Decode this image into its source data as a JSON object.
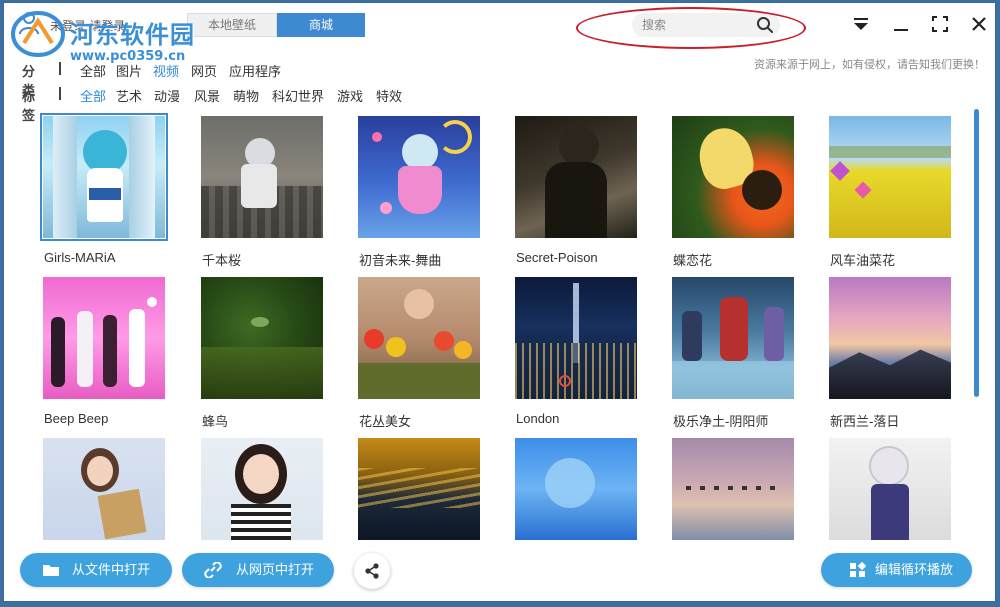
{
  "titlebar": {
    "user_status": "未登录 请登录",
    "tabs": [
      {
        "label": "本地壁纸",
        "active": false
      },
      {
        "label": "商城",
        "active": true
      }
    ],
    "search": {
      "placeholder": "搜索",
      "value": ""
    },
    "watermark": {
      "title": "河东软件园",
      "url": "www.pc0359.cn"
    }
  },
  "filters": {
    "category": {
      "label": "分类",
      "options": [
        "全部",
        "图片",
        "视频",
        "网页",
        "应用程序"
      ],
      "active": "视频"
    },
    "tags": {
      "label": "标签",
      "options": [
        "全部",
        "艺术",
        "动漫",
        "风景",
        "萌物",
        "科幻世界",
        "游戏",
        "特效"
      ],
      "active": "全部"
    },
    "disclaimer": "资源来源于网上，如有侵权，请告知我们更换！"
  },
  "items": [
    {
      "title": "Girls-MARiA",
      "selected": true
    },
    {
      "title": "千本桜"
    },
    {
      "title": "初音未来-舞曲"
    },
    {
      "title": "Secret-Poison"
    },
    {
      "title": "蝶恋花"
    },
    {
      "title": "风车油菜花"
    },
    {
      "title": "Beep Beep"
    },
    {
      "title": "蜂鸟"
    },
    {
      "title": "花丛美女"
    },
    {
      "title": "London"
    },
    {
      "title": "极乐净土-阴阳师"
    },
    {
      "title": "新西兰-落日"
    },
    {
      "title": ""
    },
    {
      "title": ""
    },
    {
      "title": ""
    },
    {
      "title": ""
    },
    {
      "title": ""
    },
    {
      "title": ""
    }
  ],
  "actions": {
    "open_file": "从文件中打开",
    "open_web": "从网页中打开",
    "edit_loop": "编辑循环播放"
  },
  "colors": {
    "accent": "#3d8ad1",
    "button": "#3ea2df",
    "active_filter": "#2f8ad8",
    "annotation": "#c8202a"
  }
}
